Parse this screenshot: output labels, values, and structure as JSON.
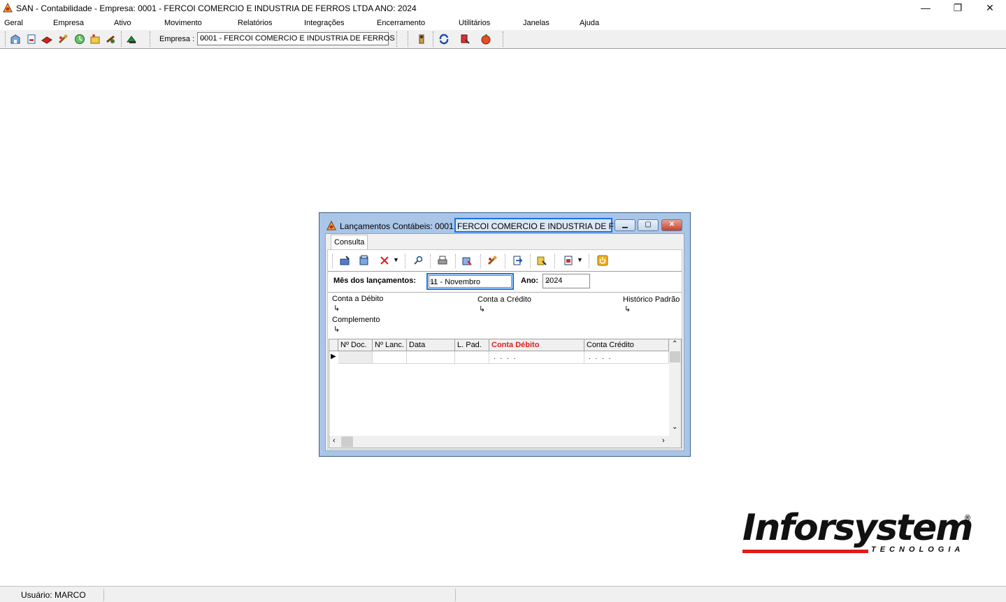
{
  "window": {
    "title": "SAN - Contabilidade - Empresa: 0001 - FERCOI COMERCIO E INDUSTRIA DE FERROS LTDA ANO: 2024",
    "minimize": "—",
    "maximize": "❐",
    "close": "✕"
  },
  "menu": [
    "Geral",
    "Empresa",
    "Ativo",
    "Movimento",
    "Relatórios",
    "Integrações",
    "Encerramento",
    "Utilitários",
    "Janelas",
    "Ajuda"
  ],
  "toolbar": {
    "empresa_label": "Empresa :",
    "empresa_value": "0001 - FERCOI COMERCIO E INDUSTRIA DE FERROS"
  },
  "child": {
    "title_prefix": "Lançamentos Contábeis: 0001 -",
    "title_highlight": "FERCOI COMERCIO E INDUSTRIA DE FER...",
    "tab": "Consulta",
    "mes_label": "Mês dos lançamentos:",
    "mes_value": "11 - Novembro",
    "ano_label": "Ano:",
    "ano_value": "2024",
    "conta_debito_label": "Conta a Débito",
    "conta_credito_label": "Conta a Crédito",
    "historico_label": "Histórico Padrão",
    "complemento_label": "Complemento",
    "arrow": "↳",
    "grid": {
      "columns": [
        "Nº Doc.",
        "Nº Lanc.",
        "Data",
        "L. Pad.",
        "Conta Débito",
        "Conta Crédito"
      ],
      "row": [
        "",
        "",
        "",
        "",
        ". . . .",
        ". . . ."
      ]
    }
  },
  "logo": {
    "name": "Inforsystem",
    "reg": "®",
    "sub": "TECNOLOGIA"
  },
  "status": {
    "user": "Usuário: MARCO"
  }
}
